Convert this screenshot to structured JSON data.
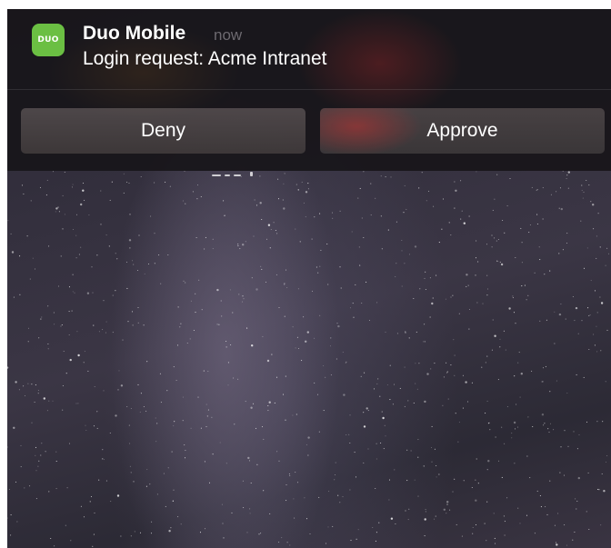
{
  "notification": {
    "app_name": "Duo Mobile",
    "app_icon": {
      "name": "duo-icon",
      "text": "DUO",
      "color": "#6bbf43"
    },
    "time": "now",
    "message": "Login request: Acme Intranet"
  },
  "actions": {
    "deny_label": "Deny",
    "approve_label": "Approve"
  },
  "colors": {
    "banner_bg": "#18161a",
    "text": "#ffffff",
    "time_text": "#6d6a70"
  }
}
